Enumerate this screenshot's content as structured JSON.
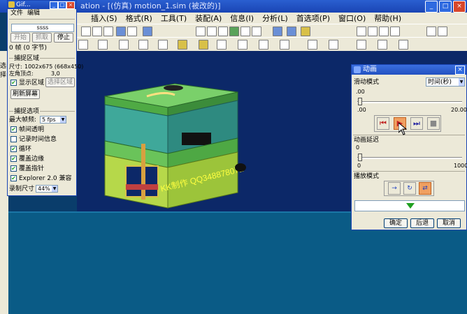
{
  "app": {
    "title": "ation - [(仿真) motion_1.sim (被改的)]",
    "menu": [
      "插入(S)",
      "格式(R)",
      "工具(T)",
      "装配(A)",
      "信息(I)",
      "分析(L)",
      "首选项(P)",
      "窗口(O)",
      "帮助(H)"
    ],
    "side_label": "选择"
  },
  "gif_recorder": {
    "title": "Gif...",
    "menu": [
      "文件",
      "编辑"
    ],
    "name_value": "ssss",
    "buttons": {
      "start": "开始",
      "capture": "抓取",
      "stop": "停止"
    },
    "frames_text": "0 帧 (0 字节)",
    "capture_area_label": "捕捉区域",
    "size_label": "尺寸:",
    "size_value": "1002x675  (668x450)",
    "topleft_label": "左角顶点:",
    "topleft_value": "3,0",
    "show_area_label": "显示区域",
    "select_area_button": "选择区域",
    "refresh_button": "刷新屏幕",
    "capture_options_label": "捕捉选项",
    "max_fps_label": "最大帧频:",
    "max_fps_value": "5 fps",
    "options": [
      {
        "label": "帧间透明",
        "checked": true
      },
      {
        "label": "记录时间信息",
        "checked": false
      },
      {
        "label": "循环",
        "checked": true
      },
      {
        "label": "覆盖边缘",
        "checked": true
      },
      {
        "label": "覆盖指针",
        "checked": true
      },
      {
        "label": "Explorer 2.0 兼容",
        "checked": true
      }
    ],
    "record_size_label": "录制尺寸",
    "record_size_value": "44%"
  },
  "animation": {
    "title": "动画",
    "sliding_mode_label": "滑动模式",
    "time_unit": "时间(秒)",
    "slider1_value": ".00",
    "slider1_min": ".00",
    "slider1_max": "20.00",
    "delay_label": "动画延迟",
    "delay_value": "0",
    "delay_min": "0",
    "delay_max": "1000",
    "play_mode_label": "播放模式",
    "buttons": {
      "ok": "确定",
      "back": "后退",
      "cancel": "取消"
    }
  },
  "model": {
    "watermark": "KK制作 QQ348878072"
  },
  "colors": {
    "titlebar": "#1a45b4",
    "viewport": "#0c2868",
    "floor": "#0a5b86",
    "plate_green": "#7ad06a",
    "plate_teal": "#3fa89a",
    "play_active": "#f0a060"
  }
}
